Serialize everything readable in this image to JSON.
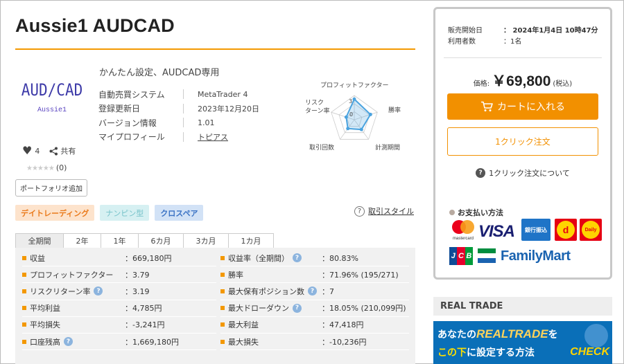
{
  "product": {
    "title": "Aussie1 AUDCAD",
    "logo_main": "AUD/CAD",
    "logo_sub": "Aussie1",
    "likes": "4",
    "share_label": "共有",
    "rating_stars": "★★★★★",
    "rating_count": "(0)",
    "portfolio_button": "ポートフォリオ追加",
    "description": "かんたん設定、AUDCAD専用",
    "info": [
      {
        "label": "自動売買システム",
        "value": "MetaTrader 4"
      },
      {
        "label": "登録更新日",
        "value": "2023年12月20日"
      },
      {
        "label": "バージョン情報",
        "value": "1.01"
      },
      {
        "label": "マイプロフィール",
        "value": "トピアス"
      }
    ]
  },
  "radar": {
    "labels": {
      "top": "プロフィットファクター",
      "right": "勝率",
      "bottom_right": "計測期間",
      "bottom_left": "取引回数",
      "left_line1": "リスク",
      "left_line2": "ターン率"
    },
    "scale_outer": "3",
    "scale_inner": "0",
    "levels": [
      0.85,
      0.7,
      0.5,
      0.45,
      0.35
    ]
  },
  "tags": [
    "デイトレーディング",
    "ナンピン型",
    "クロスペア"
  ],
  "style_link": "取引スタイル",
  "periods": [
    "全期間",
    "2年",
    "1年",
    "6カ月",
    "3カ月",
    "1カ月"
  ],
  "stats_left": [
    {
      "label": "収益",
      "value": "：669,180円",
      "help": false
    },
    {
      "label": "プロフィットファクター",
      "value": "：3.79",
      "help": false
    },
    {
      "label": "リスクリターン率",
      "value": "：3.19",
      "help": true
    },
    {
      "label": "平均利益",
      "value": "：4,785円",
      "help": false
    },
    {
      "label": "平均損失",
      "value": "：-3,241円",
      "help": false
    },
    {
      "label": "口座残高",
      "value": "：1,669,180円",
      "help": true
    }
  ],
  "stats_right": [
    {
      "label": "収益率（全期間）",
      "value": "：80.83%",
      "help": true
    },
    {
      "label": "勝率",
      "value": "：71.96% (195/271)",
      "help": false
    },
    {
      "label": "最大保有ポジション数",
      "value": "：7",
      "help": true
    },
    {
      "label": "最大ドローダウン",
      "value": "：18.05% (210,099円)",
      "help": true
    },
    {
      "label": "最大利益",
      "value": "：47,418円",
      "help": false
    },
    {
      "label": "最大損失",
      "value": "：-10,236円",
      "help": false
    }
  ],
  "help_glyph": "?",
  "side": {
    "sale_start_label": "販売開始日",
    "sale_start_value": "：  2024年1月4日 10時47分",
    "users_label": "利用者数",
    "users_value": "：1名",
    "price_label": "価格:",
    "price_value": "￥69,800",
    "price_tax": "(税込)",
    "cart_button": "カートに入れる",
    "oneclick_button": "1クリック注文",
    "oneclick_about": "1クリック注文について",
    "payment_title": "お支払い方法",
    "pay": {
      "mastercard": "mastercard",
      "visa": "VISA",
      "bank": "銀行振込",
      "d_letter": "d",
      "d_daily": "Daily",
      "jcb": [
        "J",
        "C",
        "B"
      ],
      "familymart": "FamilyMart"
    }
  },
  "realtrade": {
    "heading": "REAL TRADE",
    "line1_a": "あなたの",
    "line1_brand": "REALTRADE",
    "line1_b": "を",
    "line2_a": "この下",
    "line2_b": "に設定する方法",
    "check": "CHECK"
  },
  "colors": {
    "accent": "#f39800",
    "cart": "#f29000",
    "tag_orange": "#ea7a1b",
    "tag_blue": "#3a72c4",
    "radar": "#4aa3df"
  }
}
